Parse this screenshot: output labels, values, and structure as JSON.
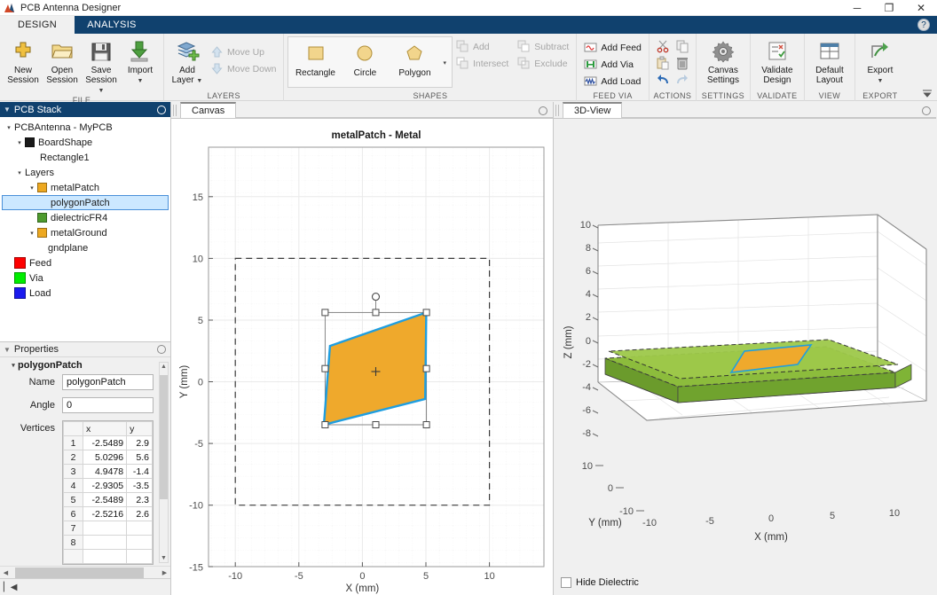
{
  "window": {
    "title": "PCB Antenna Designer",
    "minimize": "─",
    "maximize": "❐",
    "close": "✕",
    "help": "?"
  },
  "ribbon": {
    "tabs": [
      {
        "label": "DESIGN",
        "active": true
      },
      {
        "label": "ANALYSIS",
        "active": false
      }
    ],
    "groups": [
      {
        "name": "FILE",
        "label": "FILE",
        "buttons": [
          {
            "label": "New\nSession",
            "line1": "New",
            "line2": "Session",
            "icon": "new-session-icon",
            "dropdown": false
          },
          {
            "label": "Open\nSession",
            "line1": "Open",
            "line2": "Session",
            "icon": "open-session-icon",
            "dropdown": false
          },
          {
            "label": "Save\nSession",
            "line1": "Save",
            "line2": "Session",
            "icon": "save-session-icon",
            "dropdown": true
          },
          {
            "label": "Import",
            "line1": "Import",
            "line2": "",
            "icon": "import-icon",
            "dropdown": true
          }
        ]
      },
      {
        "name": "LAYERS",
        "label": "LAYERS",
        "add_layer": {
          "line1": "Add",
          "line2": "Layer",
          "icon": "add-layer-icon",
          "dropdown": true
        },
        "move_up": {
          "label": "Move Up",
          "icon": "arrow-up-icon",
          "disabled": true
        },
        "move_down": {
          "label": "Move Down",
          "icon": "arrow-down-icon",
          "disabled": true
        }
      },
      {
        "name": "SHAPES",
        "label": "SHAPES",
        "shapes": [
          {
            "label": "Rectangle",
            "icon": "rectangle-icon"
          },
          {
            "label": "Circle",
            "icon": "circle-icon"
          },
          {
            "label": "Polygon",
            "icon": "polygon-icon"
          }
        ],
        "expander": "▾",
        "boolean_ops": [
          {
            "label": "Add",
            "icon": "boolean-add-icon",
            "disabled": true
          },
          {
            "label": "Subtract",
            "icon": "boolean-subtract-icon",
            "disabled": true
          },
          {
            "label": "Intersect",
            "icon": "boolean-intersect-icon",
            "disabled": true
          },
          {
            "label": "Exclude",
            "icon": "boolean-exclude-icon",
            "disabled": true
          }
        ]
      },
      {
        "name": "FEED VIA",
        "label": "FEED VIA",
        "items": [
          {
            "label": "Add Feed",
            "icon": "add-feed-icon"
          },
          {
            "label": "Add Via",
            "icon": "add-via-icon"
          },
          {
            "label": "Add Load",
            "icon": "add-load-icon"
          }
        ]
      },
      {
        "name": "ACTIONS",
        "label": "ACTIONS",
        "icons": [
          {
            "name": "cut-icon"
          },
          {
            "name": "copy-icon"
          },
          {
            "name": "paste-icon"
          },
          {
            "name": "delete-icon"
          },
          {
            "name": "undo-icon"
          },
          {
            "name": "redo-icon"
          }
        ]
      },
      {
        "name": "SETTINGS",
        "label": "SETTINGS",
        "button": {
          "line1": "Canvas",
          "line2": "Settings",
          "icon": "canvas-settings-icon"
        }
      },
      {
        "name": "VALIDATE",
        "label": "VALIDATE",
        "button": {
          "line1": "Validate",
          "line2": "Design",
          "icon": "validate-design-icon"
        }
      },
      {
        "name": "VIEW",
        "label": "VIEW",
        "button": {
          "line1": "Default",
          "line2": "Layout",
          "icon": "default-layout-icon"
        }
      },
      {
        "name": "EXPORT",
        "label": "EXPORT",
        "button": {
          "line1": "Export",
          "line2": "",
          "icon": "export-icon",
          "dropdown": true
        }
      }
    ],
    "collapse_icon": "⤒"
  },
  "pcb_stack": {
    "title": "PCB Stack",
    "nodes": [
      {
        "label": "PCBAntenna - MyPCB",
        "depth": 0,
        "caret": "▾",
        "swatch": null,
        "selected": false
      },
      {
        "label": "BoardShape",
        "depth": 1,
        "caret": "▾",
        "swatch": "#1a1a1a",
        "selected": false
      },
      {
        "label": "Rectangle1",
        "depth": 3,
        "caret": "",
        "swatch": null,
        "selected": false
      },
      {
        "label": "Layers",
        "depth": 1,
        "caret": "▾",
        "swatch": null,
        "selected": false
      },
      {
        "label": "metalPatch",
        "depth": 2,
        "caret": "▾",
        "swatch": "#eda820",
        "selected": false
      },
      {
        "label": "polygonPatch",
        "depth": 4,
        "caret": "",
        "swatch": null,
        "selected": true
      },
      {
        "label": "dielectricFR4",
        "depth": 3,
        "caret": "",
        "swatch": "#4e9b2e",
        "selected": false
      },
      {
        "label": "metalGround",
        "depth": 2,
        "caret": "▾",
        "swatch": "#eda820",
        "selected": false
      },
      {
        "label": "gndplane",
        "depth": 4,
        "caret": "",
        "swatch": null,
        "selected": false
      },
      {
        "label": "Feed",
        "depth": 1,
        "caret": "",
        "swatch": "#fe0000",
        "selected": false
      },
      {
        "label": "Via",
        "depth": 1,
        "caret": "",
        "swatch": "#00ee00",
        "selected": false
      },
      {
        "label": "Load",
        "depth": 1,
        "caret": "",
        "swatch": "#1a1aee",
        "selected": false
      }
    ]
  },
  "properties": {
    "title": "Properties",
    "object_name": "polygonPatch",
    "caret": "▾",
    "fields": [
      {
        "label": "Name",
        "value": "polygonPatch"
      },
      {
        "label": "Angle",
        "value": "0"
      }
    ],
    "vertices_label": "Vertices",
    "vertices_headers": [
      "",
      "x",
      "y"
    ],
    "vertices_rows": [
      {
        "index": "1",
        "x": "-2.5489",
        "y": "2.9"
      },
      {
        "index": "2",
        "x": "5.0296",
        "y": "5.6"
      },
      {
        "index": "3",
        "x": "4.9478",
        "y": "-1.4"
      },
      {
        "index": "4",
        "x": "-2.9305",
        "y": "-3.5"
      },
      {
        "index": "5",
        "x": "-2.5489",
        "y": "2.3"
      },
      {
        "index": "6",
        "x": "-2.5216",
        "y": "2.6"
      },
      {
        "index": "7",
        "x": "",
        "y": ""
      },
      {
        "index": "8",
        "x": "",
        "y": ""
      }
    ],
    "scroll_left_icon": "◀",
    "scroll_right_icon": "▶",
    "scroll_up_icon": "▲",
    "scroll_down_icon": "▼"
  },
  "statusbar": {
    "icon": "▏◀"
  },
  "canvas_panel": {
    "tab_label": "Canvas",
    "close_dot": "○"
  },
  "view3d_panel": {
    "tab_label": "3D-View",
    "close_dot": "○",
    "hide_dielectric_label": "Hide Dielectric",
    "hide_dielectric_checked": false
  },
  "chart_data": [
    {
      "type": "scatter",
      "id": "canvas-2d",
      "title": "metalPatch - Metal",
      "xlabel": "X (mm)",
      "ylabel": "Y (mm)",
      "xlim": [
        -13.2,
        13.2
      ],
      "ylim": [
        -17.0,
        17.0
      ],
      "xticks": [
        -10,
        -5,
        0,
        5,
        10
      ],
      "yticks": [
        -15,
        -10,
        -5,
        0,
        5,
        10,
        15
      ],
      "grid": true,
      "board_outline": {
        "x": [
          -10,
          10
        ],
        "y": [
          -10,
          10
        ],
        "style": "dashed"
      },
      "polygon_vertices": [
        {
          "x": -2.5489,
          "y": 2.9
        },
        {
          "x": 5.0296,
          "y": 5.6
        },
        {
          "x": 4.9478,
          "y": -1.4
        },
        {
          "x": -2.9305,
          "y": -3.5
        }
      ],
      "polygon_fill": "#efa92c",
      "polygon_edge": "#1f9ee0",
      "selection_box": {
        "x": [
          -2.9305,
          5.0296
        ],
        "y": [
          -3.5,
          5.6
        ]
      },
      "rotation_handle": {
        "x": 1.05,
        "y": 6.9
      },
      "center_marker": {
        "x": 1.05,
        "y": 1.2
      }
    },
    {
      "type": "surface",
      "id": "view-3d",
      "xlabel": "X (mm)",
      "ylabel": "Y (mm)",
      "zlabel": "Z (mm)",
      "xticks": [
        -10,
        -5,
        0,
        5,
        10
      ],
      "yticks": [
        -10,
        0,
        10
      ],
      "zticks": [
        -8,
        -6,
        -4,
        -2,
        0,
        2,
        4,
        6,
        8,
        10
      ],
      "zlim": [
        -10,
        10
      ],
      "layers": [
        {
          "name": "metalPatch",
          "color": "#efa92c",
          "edge": "#1f9ee0"
        },
        {
          "name": "dielectricFR4",
          "color": "#7fb436"
        },
        {
          "name": "metalGround",
          "color": "#8cbc3c"
        }
      ]
    }
  ]
}
